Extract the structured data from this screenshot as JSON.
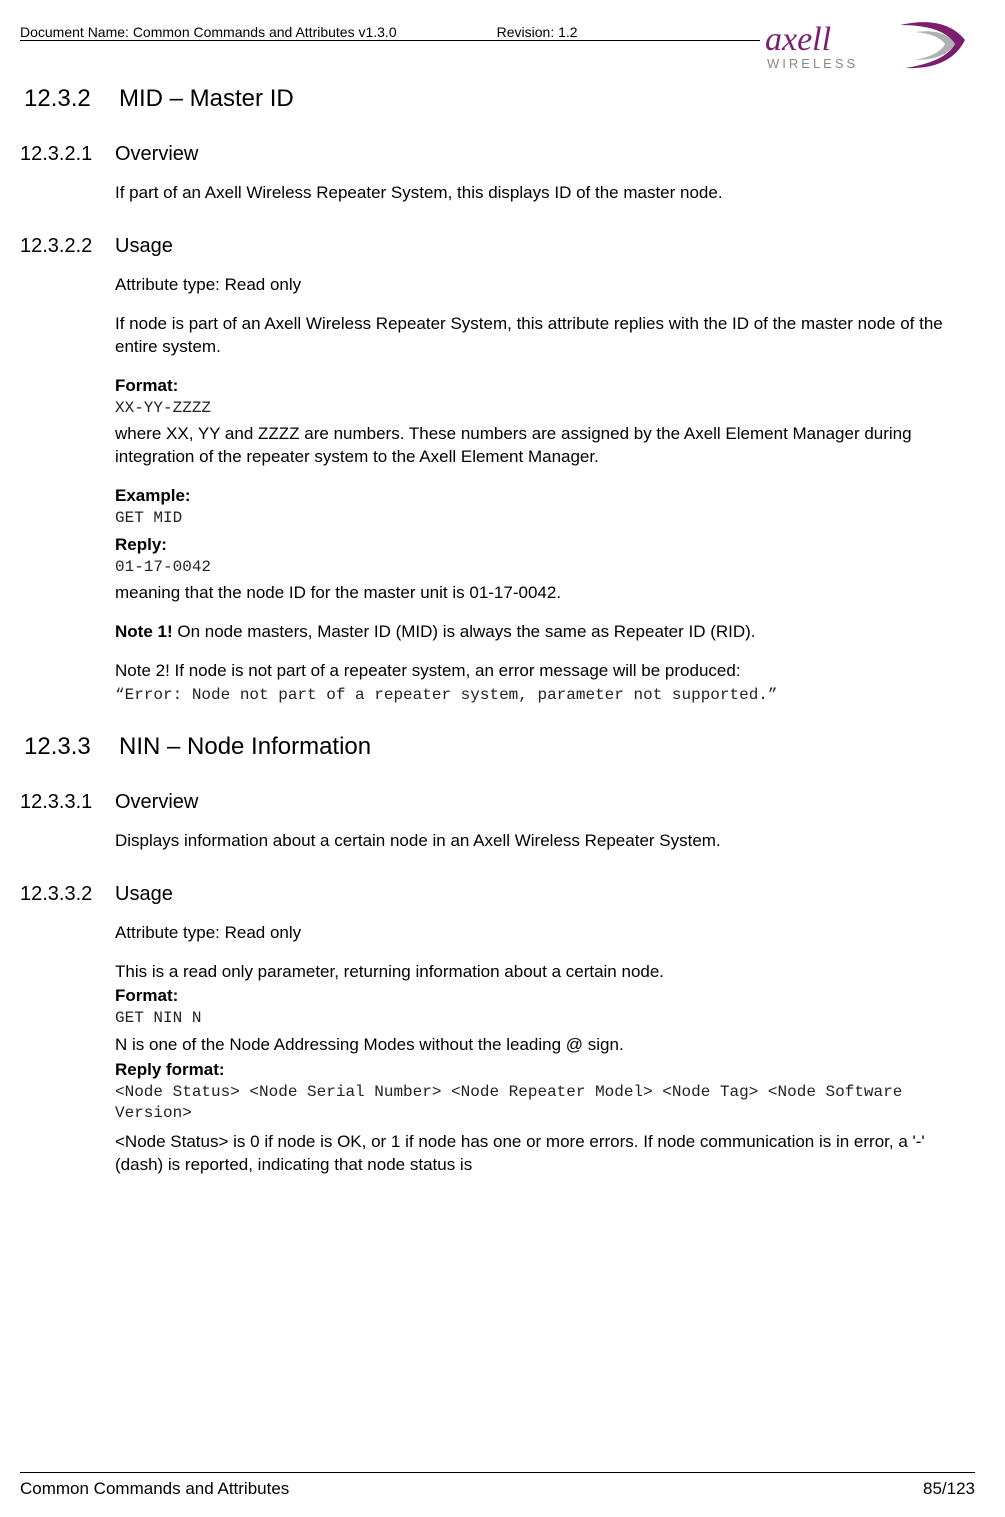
{
  "header": {
    "doc_name": "Document Name: Common Commands and Attributes v1.3.0",
    "revision": "Revision: 1.2",
    "logo_brand": "axell",
    "logo_sub": "WIRELESS"
  },
  "s1": {
    "num": "12.3.2",
    "title": "MID – Master ID"
  },
  "s1_1": {
    "num": "12.3.2.1",
    "title": "Overview",
    "p1": "If part of an Axell Wireless Repeater System, this displays ID of the master node."
  },
  "s1_2": {
    "num": "12.3.2.2",
    "title": "Usage",
    "attr_type": "Attribute type: Read only",
    "p1": "If node is part of an Axell Wireless Repeater System, this attribute replies with the ID of the master node of the entire system.",
    "format_lbl": "Format:",
    "format_val": "XX-YY-ZZZZ",
    "format_desc": "where XX, YY and ZZZZ are numbers. These numbers are assigned by the Axell Element Manager during integration of the repeater system to the Axell Element Manager.",
    "example_lbl": "Example:",
    "example_val": "GET MID",
    "reply_lbl": "Reply:",
    "reply_val": "01-17-0042",
    "reply_desc": "meaning that the node ID for the master unit is 01-17-0042.",
    "note1_lbl": "Note 1!",
    "note1_txt": " On node masters, Master ID (MID) is always the same as Repeater ID (RID).",
    "note2_txt": "Note 2! If node is not part of a repeater system, an error message will be produced:",
    "note2_err": "“Error: Node not part of a repeater system, parameter not supported.”"
  },
  "s2": {
    "num": "12.3.3",
    "title": "NIN – Node Information"
  },
  "s2_1": {
    "num": "12.3.3.1",
    "title": "Overview",
    "p1": "Displays information about a certain node in an Axell Wireless Repeater System."
  },
  "s2_2": {
    "num": "12.3.3.2",
    "title": "Usage",
    "attr_type": "Attribute type: Read only",
    "p1": "This is a read only parameter, returning information about a certain node.",
    "format_lbl": "Format:",
    "format_val": "GET NIN N",
    "n_desc": "N is one of the Node Addressing Modes without the leading @ sign.",
    "reply_fmt_lbl": "Reply format:",
    "reply_fmt_val": "<Node Status> <Node Serial Number> <Node Repeater Model> <Node Tag> <Node Software Version>",
    "status_desc": "<Node Status> is 0 if node is OK, or 1 if node has one or more errors. If node communication is in error, a '-' (dash) is reported, indicating that node status is"
  },
  "footer": {
    "title": "Common Commands and Attributes",
    "page": "85/123"
  }
}
